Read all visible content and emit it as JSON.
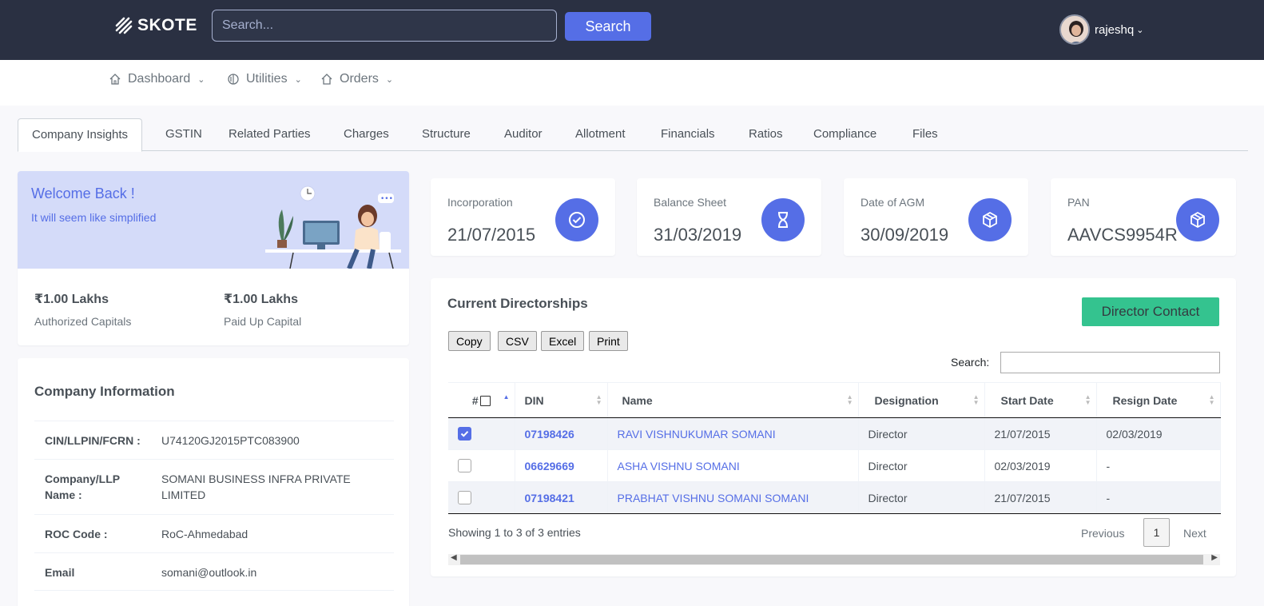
{
  "header": {
    "logo_text": "SKOTE",
    "search_placeholder": "Search...",
    "search_button": "Search",
    "username": "rajeshq"
  },
  "nav": [
    {
      "label": "Dashboard"
    },
    {
      "label": "Utilities"
    },
    {
      "label": "Orders"
    }
  ],
  "tabs": [
    "Company Insights",
    "GSTIN",
    "Related Parties",
    "Charges",
    "Structure",
    "Auditor",
    "Allotment",
    "Financials",
    "Ratios",
    "Compliance",
    "Files"
  ],
  "welcome": {
    "title": "Welcome Back !",
    "subtitle": "It will seem like simplified",
    "authorized_value": "₹1.00 Lakhs",
    "authorized_label": "Authorized Capitals",
    "paidup_value": "₹1.00 Lakhs",
    "paidup_label": "Paid Up Capital"
  },
  "company_info": {
    "title": "Company Information",
    "rows": [
      {
        "key": "CIN/LLPIN/FCRN :",
        "value": "U74120GJ2015PTC083900"
      },
      {
        "key": "Company/LLP Name :",
        "value": "SOMANI BUSINESS INFRA PRIVATE LIMITED"
      },
      {
        "key": "ROC Code :",
        "value": "RoC-Ahmedabad"
      },
      {
        "key": "Email",
        "value": "somani@outlook.in"
      }
    ]
  },
  "stats": [
    {
      "label": "Incorporation",
      "value": "21/07/2015",
      "icon": "check-circle-icon"
    },
    {
      "label": "Balance Sheet",
      "value": "31/03/2019",
      "icon": "hourglass-icon"
    },
    {
      "label": "Date of AGM",
      "value": "30/09/2019",
      "icon": "cube-icon"
    },
    {
      "label": "PAN",
      "value": "AAVCS9954R",
      "icon": "cube-icon"
    }
  ],
  "directorships": {
    "title": "Current Directorships",
    "contact_button": "Director Contact",
    "export_buttons": [
      "Copy",
      "CSV",
      "Excel",
      "Print"
    ],
    "search_label": "Search:",
    "columns": [
      "#",
      "DIN",
      "Name",
      "Designation",
      "Start Date",
      "Resign Date"
    ],
    "rows": [
      {
        "checked": true,
        "din": "07198426",
        "name": "RAVI VISHNUKUMAR SOMANI",
        "designation": "Director",
        "start": "21/07/2015",
        "resign": "02/03/2019"
      },
      {
        "checked": false,
        "din": "06629669",
        "name": "ASHA VISHNU SOMANI",
        "designation": "Director",
        "start": "02/03/2019",
        "resign": "-"
      },
      {
        "checked": false,
        "din": "07198421",
        "name": "PRABHAT VISHNU SOMANI SOMANI",
        "designation": "Director",
        "start": "21/07/2015",
        "resign": "-"
      }
    ],
    "showing_text": "Showing 1 to 3 of 3 entries",
    "prev_label": "Previous",
    "page": "1",
    "next_label": "Next"
  },
  "colors": {
    "topbar": "#2a3042",
    "primary": "#556ee6",
    "success": "#34c38f",
    "welcome_bg": "#d4dbf9"
  }
}
